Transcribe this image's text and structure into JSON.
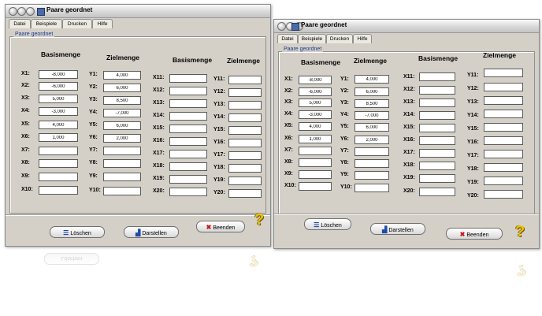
{
  "window": {
    "title": "Paare geordnet",
    "menu": [
      "Datei",
      "Beispiele",
      "Drucken",
      "Hilfe"
    ],
    "group_title": "Paare geordnet",
    "headers": [
      "Basismenge",
      "Zielmenge",
      "Basismenge",
      "Zielmenge"
    ],
    "x_labels": [
      "X1:",
      "X2:",
      "X3:",
      "X4:",
      "X5:",
      "X6:",
      "X7:",
      "X8:",
      "X9:",
      "X10:"
    ],
    "y_labels": [
      "Y1:",
      "Y2:",
      "Y3:",
      "Y4:",
      "Y5:",
      "Y6:",
      "Y7:",
      "Y8:",
      "Y9:",
      "Y10:"
    ],
    "x2_labels": [
      "X11:",
      "X12:",
      "X13:",
      "X14:",
      "X15:",
      "X16:",
      "X17:",
      "X18:",
      "X19:",
      "X20:"
    ],
    "y2_labels": [
      "Y11:",
      "Y12:",
      "Y13:",
      "Y14:",
      "Y15:",
      "Y16:",
      "Y17:",
      "Y18:",
      "Y19:",
      "Y20:"
    ],
    "x_values": [
      "-8,000",
      "-6,000",
      "5,000",
      "-3,000",
      "4,000",
      "1,000",
      "",
      "",
      "",
      ""
    ],
    "y_values": [
      "4,000",
      "6,000",
      "8,500",
      "-7,000",
      "6,000",
      "2,000",
      "",
      "",
      "",
      ""
    ],
    "buttons": {
      "clear": {
        "label": "Löschen",
        "icon": "clear-list-icon"
      },
      "plot": {
        "label": "Darstellen",
        "icon": "chart-icon"
      },
      "exit": {
        "label": "Beenden",
        "icon": "red-x-icon"
      },
      "help": {
        "icon": "help-question-icon",
        "glyph": "?"
      }
    }
  },
  "colors": {
    "window_bg": "#d4d0c8",
    "legend_text": "#1a3d8f",
    "exit_x": "#c8151b",
    "help": "#f1c400"
  }
}
